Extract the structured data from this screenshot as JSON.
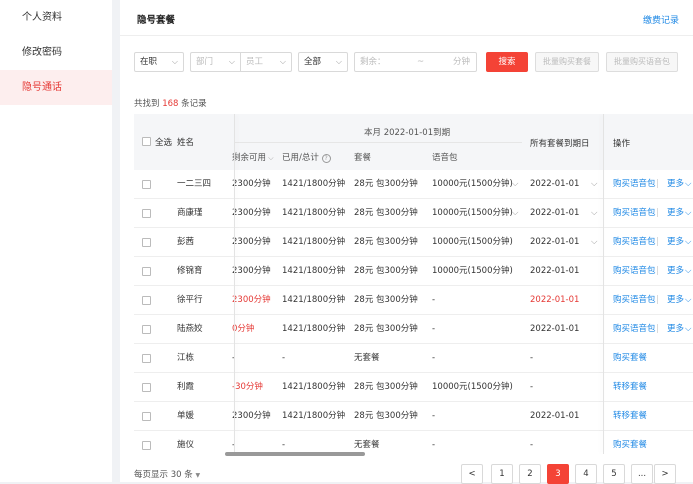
{
  "sidebar": {
    "items": [
      {
        "label": "个人资料"
      },
      {
        "label": "修改密码"
      },
      {
        "label": "隐号通话"
      }
    ]
  },
  "header": {
    "title": "隐号套餐",
    "fee_link": "缴费记录"
  },
  "filters": {
    "status": "在职",
    "department_placeholder": "部门",
    "employee_placeholder": "员工",
    "package_scope": "全部",
    "remaining_label": "剩余：",
    "remaining_range_sep": "~",
    "remaining_unit": "分钟",
    "search_label": "搜索",
    "batch_package_label": "批量购买套餐",
    "batch_voice_label": "批量购买语音包"
  },
  "summary": {
    "prefix": "共找到",
    "count": "168",
    "suffix": "条记录"
  },
  "table": {
    "select_all": "全选",
    "col_name": "姓名",
    "group_title": "本月 2022-01-01到期",
    "col_remaining": "剩余可用",
    "col_used": "已用/总计",
    "col_package": "套餐",
    "col_voice": "语音包",
    "col_expire": "所有套餐到期日",
    "col_ops": "操作",
    "rows": [
      {
        "name": "一二三四",
        "remaining": "2300分钟",
        "remaining_red": false,
        "used": "1421/1800分钟",
        "package": "28元 包300分钟",
        "voice": "10000元(1500分钟)",
        "voice_dd": true,
        "expire": "2022-01-01",
        "expire_red": false,
        "expire_dd": true,
        "op1": "购买语音包",
        "op2": "更多"
      },
      {
        "name": "商康瑾",
        "remaining": "2300分钟",
        "remaining_red": false,
        "used": "1421/1800分钟",
        "package": "28元 包300分钟",
        "voice": "10000元(1500分钟)",
        "voice_dd": true,
        "expire": "2022-01-01",
        "expire_red": false,
        "expire_dd": true,
        "op1": "购买语音包",
        "op2": "更多"
      },
      {
        "name": "彭茜",
        "remaining": "2300分钟",
        "remaining_red": false,
        "used": "1421/1800分钟",
        "package": "28元 包300分钟",
        "voice": "10000元(1500分钟)",
        "voice_dd": false,
        "expire": "2022-01-01",
        "expire_red": false,
        "expire_dd": true,
        "op1": "购买语音包",
        "op2": "更多"
      },
      {
        "name": "修锦育",
        "remaining": "2300分钟",
        "remaining_red": false,
        "used": "1421/1800分钟",
        "package": "28元 包300分钟",
        "voice": "10000元(1500分钟)",
        "voice_dd": false,
        "expire": "2022-01-01",
        "expire_red": false,
        "expire_dd": false,
        "op1": "购买语音包",
        "op2": "更多"
      },
      {
        "name": "徐平行",
        "remaining": "2300分钟",
        "remaining_red": true,
        "used": "1421/1800分钟",
        "package": "28元 包300分钟",
        "voice": "-",
        "voice_dd": false,
        "expire": "2022-01-01",
        "expire_red": true,
        "expire_dd": false,
        "op1": "购买语音包",
        "op2": "更多"
      },
      {
        "name": "陆燕姣",
        "remaining": "0分钟",
        "remaining_red": true,
        "used": "1421/1800分钟",
        "package": "28元 包300分钟",
        "voice": "-",
        "voice_dd": false,
        "expire": "2022-01-01",
        "expire_red": false,
        "expire_dd": false,
        "op1": "购买语音包",
        "op2": "更多"
      },
      {
        "name": "江栋",
        "remaining": "-",
        "remaining_red": false,
        "used": "-",
        "package": "无套餐",
        "voice": "-",
        "voice_dd": false,
        "expire": "-",
        "expire_red": false,
        "expire_dd": false,
        "op1": "购买套餐",
        "op2": ""
      },
      {
        "name": "利霞",
        "remaining": "-30分钟",
        "remaining_red": true,
        "used": "1421/1800分钟",
        "package": "28元 包300分钟",
        "voice": "10000元(1500分钟)",
        "voice_dd": false,
        "expire": "-",
        "expire_red": false,
        "expire_dd": false,
        "op1": "转移套餐",
        "op2": ""
      },
      {
        "name": "单媛",
        "remaining": "2300分钟",
        "remaining_red": false,
        "used": "1421/1800分钟",
        "package": "28元 包300分钟",
        "voice": "-",
        "voice_dd": false,
        "expire": "2022-01-01",
        "expire_red": false,
        "expire_dd": false,
        "op1": "转移套餐",
        "op2": ""
      },
      {
        "name": "施仪",
        "remaining": "-",
        "remaining_red": false,
        "used": "-",
        "package": "无套餐",
        "voice": "-",
        "voice_dd": false,
        "expire": "-",
        "expire_red": false,
        "expire_dd": false,
        "op1": "购买套餐",
        "op2": ""
      }
    ]
  },
  "pagination": {
    "per_page": "每页显示 30 条",
    "pages": [
      "1",
      "2",
      "3",
      "4",
      "5",
      "..."
    ],
    "active_page": "3"
  },
  "colors": {
    "accent": "#f44336",
    "link": "#1e88e5",
    "warn_text": "#e53935"
  }
}
